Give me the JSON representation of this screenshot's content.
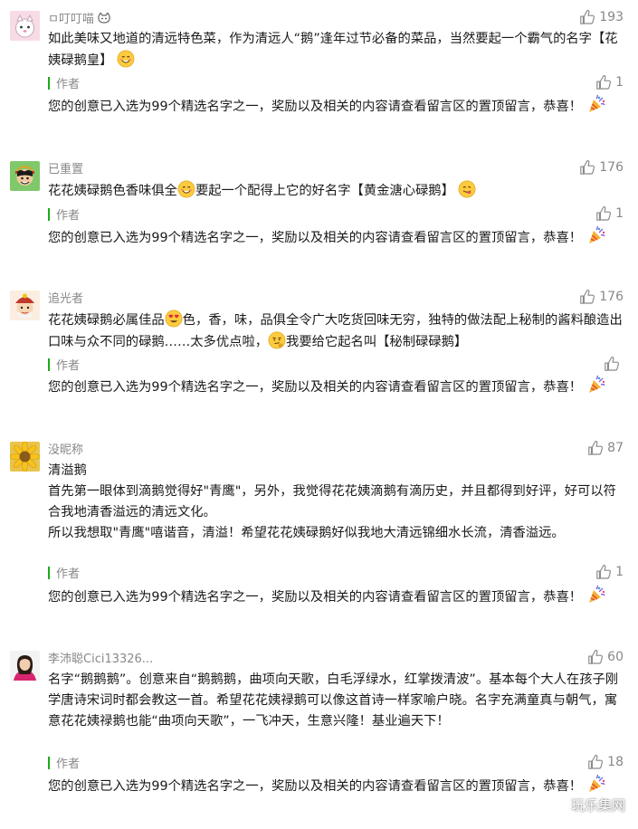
{
  "comments": [
    {
      "username": "ㅁ叮叮喵",
      "likes": "193",
      "text": "如此美味又地道的清远特色菜，作为清远人“鹅”逢年过节必备的菜品，当然要起一个霸气的名字【花姨碌鹅皇】",
      "reply_author": "作者",
      "reply_likes": "1",
      "reply_text": "您的创意已入选为99个精选名字之一，奖励以及相关的内容请查看留言区的置顶留言，恭喜！"
    },
    {
      "username": "已重置",
      "likes": "176",
      "text_a": "花花姨碌鹅色香味俱全",
      "text_b": "要起一个配得上它的好名字【黄金溏心碌鹅】",
      "reply_author": "作者",
      "reply_likes": "1",
      "reply_text": "您的创意已入选为99个精选名字之一，奖励以及相关的内容请查看留言区的置顶留言，恭喜！"
    },
    {
      "username": "追光者",
      "likes": "176",
      "text_a": "花花姨碌鹅必属佳品",
      "text_b": "色，香，味，品俱全令广大吃货回味无穷，独特的做法配上秘制的酱料酿造出口味与众不同的碌鹅……太多优点啦，",
      "text_c": "我要给它起名叫【秘制碌碌鹅】",
      "reply_author": "作者",
      "reply_likes": "",
      "reply_text": "您的创意已入选为99个精选名字之一，奖励以及相关的内容请查看留言区的置顶留言，恭喜！"
    },
    {
      "username": "没昵称",
      "likes": "87",
      "line1": "清溢鹅",
      "line2": "首先第一眼体到滴鹅觉得好\"青鹰\"，另外，我觉得花花姨滴鹅有滴历史，并且都得到好评，好可以符合我地清香溢远的清远文化。",
      "line3": "所以我想取\"青鹰\"嘻谐音，清溢！希望花花姨碌鹅好似我地大清远锦细水长流，清香溢远。",
      "reply_author": "作者",
      "reply_likes": "1",
      "reply_text": "您的创意已入选为99个精选名字之一，奖励以及相关的内容请查看留言区的置顶留言，恭喜！"
    },
    {
      "username": "李沛聪Cici13326...",
      "likes": "60",
      "text": "名字“鹅鹅鹅”。创意来自“鹅鹅鹅，曲项向天歌，白毛浮绿水，红掌拨清波”。基本每个大人在孩子刚学唐诗宋词时都会教这一首。希望花花姨禄鹅可以像这首诗一样家喻户晓。名字充满童真与朝气，寓意花花姨禄鹅也能“曲项向天歌”，一飞冲天，生意兴隆！基业遍天下！",
      "reply_author": "作者",
      "reply_likes": "18",
      "reply_text": "您的创意已入选为99个精选名字之一，奖励以及相关的内容请查看留言区的置顶留言，恭喜！"
    }
  ],
  "watermark": "玩乐集网",
  "colors": {
    "reply_bar": "#1aad19",
    "meta_text": "#888888"
  }
}
